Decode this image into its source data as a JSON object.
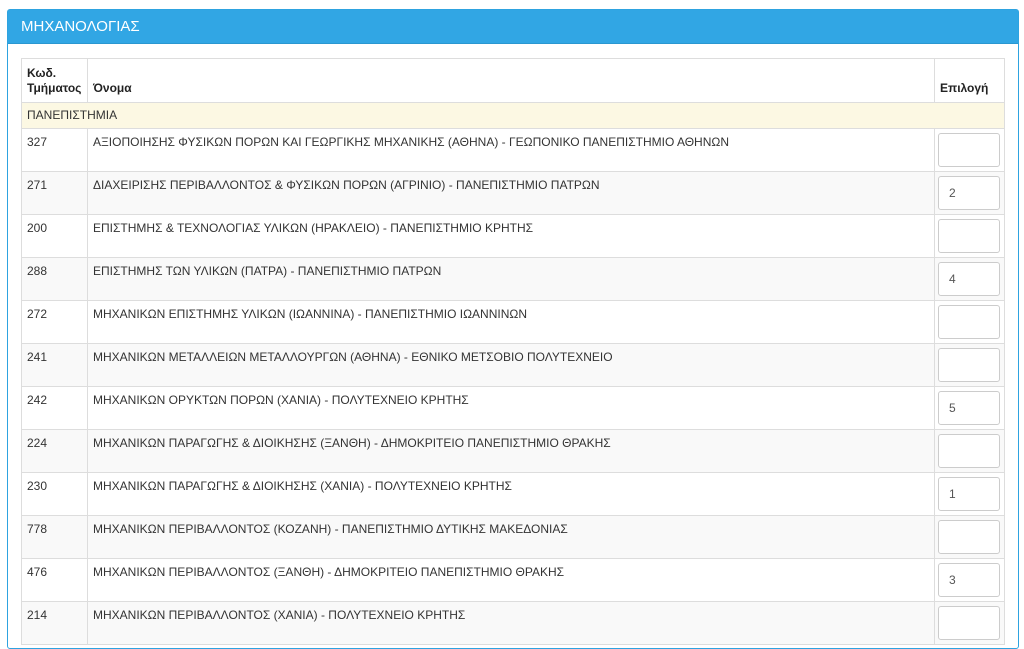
{
  "panel": {
    "title": "ΜΗΧΑΝΟΛΟΓΙΑΣ"
  },
  "table": {
    "headers": {
      "code": "Κωδ. Τμήματος",
      "name": "Όνομα",
      "choice": "Επιλογή"
    },
    "group_label": "ΠΑΝΕΠΙΣΤΗΜΙΑ",
    "rows": [
      {
        "code": "327",
        "name": "ΑΞΙΟΠΟΙΗΣΗΣ ΦΥΣΙΚΩΝ ΠΟΡΩΝ ΚΑΙ ΓΕΩΡΓΙΚΗΣ ΜΗΧΑΝΙΚΗΣ (ΑΘΗΝΑ) - ΓΕΩΠΟΝΙΚΟ ΠΑΝΕΠΙΣΤΗΜΙΟ ΑΘΗΝΩΝ",
        "choice": ""
      },
      {
        "code": "271",
        "name": "ΔΙΑΧΕΙΡΙΣΗΣ ΠΕΡΙΒΑΛΛΟΝΤΟΣ & ΦΥΣΙΚΩΝ ΠΟΡΩΝ (ΑΓΡΙΝΙΟ) - ΠΑΝΕΠΙΣΤΗΜΙΟ ΠΑΤΡΩΝ",
        "choice": "2"
      },
      {
        "code": "200",
        "name": "ΕΠΙΣΤΗΜΗΣ & ΤΕΧΝΟΛΟΓΙΑΣ ΥΛΙΚΩΝ (ΗΡΑΚΛΕΙΟ) - ΠΑΝΕΠΙΣΤΗΜΙΟ ΚΡΗΤΗΣ",
        "choice": ""
      },
      {
        "code": "288",
        "name": "ΕΠΙΣΤΗΜΗΣ ΤΩΝ ΥΛΙΚΩΝ (ΠΑΤΡΑ) - ΠΑΝΕΠΙΣΤΗΜΙΟ ΠΑΤΡΩΝ",
        "choice": "4"
      },
      {
        "code": "272",
        "name": "ΜΗΧΑΝΙΚΩΝ ΕΠΙΣΤΗΜΗΣ ΥΛΙΚΩΝ (ΙΩΑΝΝΙΝΑ) - ΠΑΝΕΠΙΣΤΗΜΙΟ ΙΩΑΝΝΙΝΩΝ",
        "choice": ""
      },
      {
        "code": "241",
        "name": "ΜΗΧΑΝΙΚΩΝ ΜΕΤΑΛΛΕΙΩΝ ΜΕΤΑΛΛΟΥΡΓΩΝ (ΑΘΗΝΑ) - ΕΘΝΙΚΟ ΜΕΤΣΟΒΙΟ ΠΟΛΥΤΕΧΝΕΙΟ",
        "choice": ""
      },
      {
        "code": "242",
        "name": "ΜΗΧΑΝΙΚΩΝ ΟΡΥΚΤΩΝ ΠΟΡΩΝ (ΧΑΝΙΑ) - ΠΟΛΥΤΕΧΝΕΙΟ ΚΡΗΤΗΣ",
        "choice": "5"
      },
      {
        "code": "224",
        "name": "ΜΗΧΑΝΙΚΩΝ ΠΑΡΑΓΩΓΗΣ & ΔΙΟΙΚΗΣΗΣ (ΞΑΝΘΗ) - ΔΗΜΟΚΡΙΤΕΙΟ ΠΑΝΕΠΙΣΤΗΜΙΟ ΘΡΑΚΗΣ",
        "choice": ""
      },
      {
        "code": "230",
        "name": "ΜΗΧΑΝΙΚΩΝ ΠΑΡΑΓΩΓΗΣ & ΔΙΟΙΚΗΣΗΣ (ΧΑΝΙΑ) - ΠΟΛΥΤΕΧΝΕΙΟ ΚΡΗΤΗΣ",
        "choice": "1"
      },
      {
        "code": "778",
        "name": "ΜΗΧΑΝΙΚΩΝ ΠΕΡΙΒΑΛΛΟΝΤΟΣ (ΚΟΖΑΝΗ) - ΠΑΝΕΠΙΣΤΗΜΙΟ ΔΥΤΙΚΗΣ ΜΑΚΕΔΟΝΙΑΣ",
        "choice": ""
      },
      {
        "code": "476",
        "name": "ΜΗΧΑΝΙΚΩΝ ΠΕΡΙΒΑΛΛΟΝΤΟΣ (ΞΑΝΘΗ) - ΔΗΜΟΚΡΙΤΕΙΟ ΠΑΝΕΠΙΣΤΗΜΙΟ ΘΡΑΚΗΣ",
        "choice": "3"
      },
      {
        "code": "214",
        "name": "ΜΗΧΑΝΙΚΩΝ ΠΕΡΙΒΑΛΛΟΝΤΟΣ (ΧΑΝΙΑ) - ΠΟΛΥΤΕΧΝΕΙΟ ΚΡΗΤΗΣ",
        "choice": ""
      }
    ]
  }
}
